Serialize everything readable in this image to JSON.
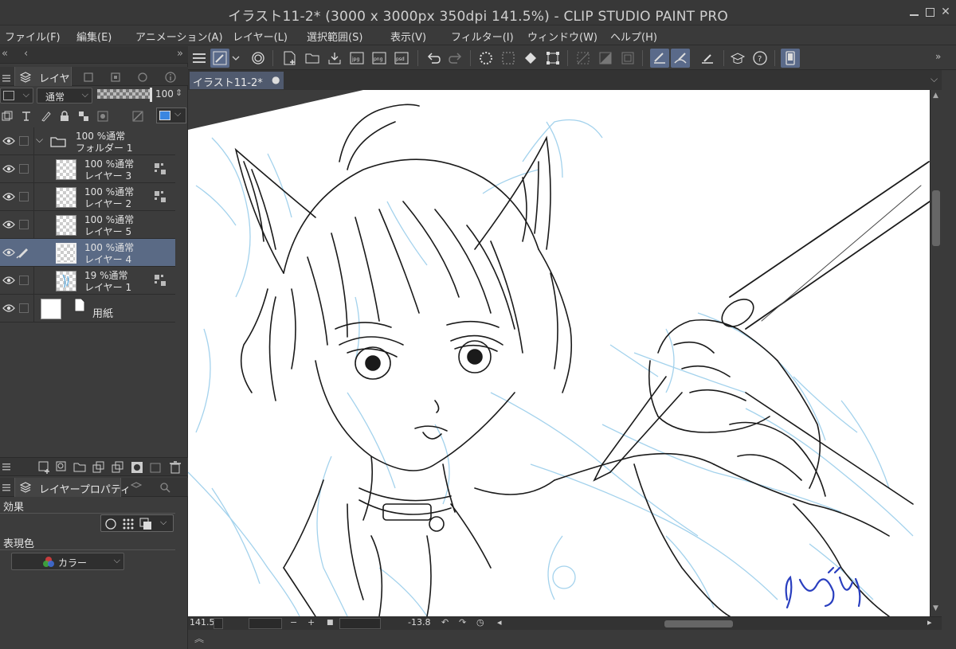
{
  "window": {
    "title": "イラスト11-2* (3000 x 3000px 350dpi 141.5%)  - CLIP STUDIO PAINT PRO"
  },
  "menu": [
    "ファイル(F)",
    "編集(E)",
    "アニメーション(A)",
    "レイヤー(L)",
    "選択範囲(S)",
    "表示(V)",
    "フィルター(I)",
    "ウィンドウ(W)",
    "ヘルプ(H)"
  ],
  "layer_panel": {
    "tab_label": "レイヤ",
    "blend_mode": "通常",
    "opacity": "100",
    "layers": [
      {
        "line1": "100 %通常",
        "line2": "フォルダー 1",
        "type": "folder",
        "reference": false,
        "selected": false
      },
      {
        "line1": "100 %通常",
        "line2": "レイヤー 3",
        "type": "raster",
        "reference": true,
        "selected": false
      },
      {
        "line1": "100 %通常",
        "line2": "レイヤー 2",
        "type": "raster",
        "reference": true,
        "selected": false
      },
      {
        "line1": "100 %通常",
        "line2": "レイヤー 5",
        "type": "raster",
        "reference": false,
        "selected": false
      },
      {
        "line1": "100 %通常",
        "line2": "レイヤー 4",
        "type": "raster",
        "reference": false,
        "selected": true
      },
      {
        "line1": "19 %通常",
        "line2": "レイヤー 1",
        "type": "raster",
        "reference": true,
        "selected": false
      },
      {
        "line1": "",
        "line2": "用紙",
        "type": "paper",
        "reference": false,
        "selected": false
      }
    ]
  },
  "property_panel": {
    "tab_label": "レイヤープロパティ",
    "effect_label": "効果",
    "color_label": "表現色",
    "color_value": "カラー"
  },
  "document_tab": {
    "label": "イラスト11-2*",
    "dot": "●"
  },
  "statusbar": {
    "zoom": "141.5",
    "angle": "-13.8"
  },
  "colors": {
    "selection": "#5a6a85",
    "sketch_blue": "#9fd0ec",
    "signature": "#2a3fbf"
  }
}
